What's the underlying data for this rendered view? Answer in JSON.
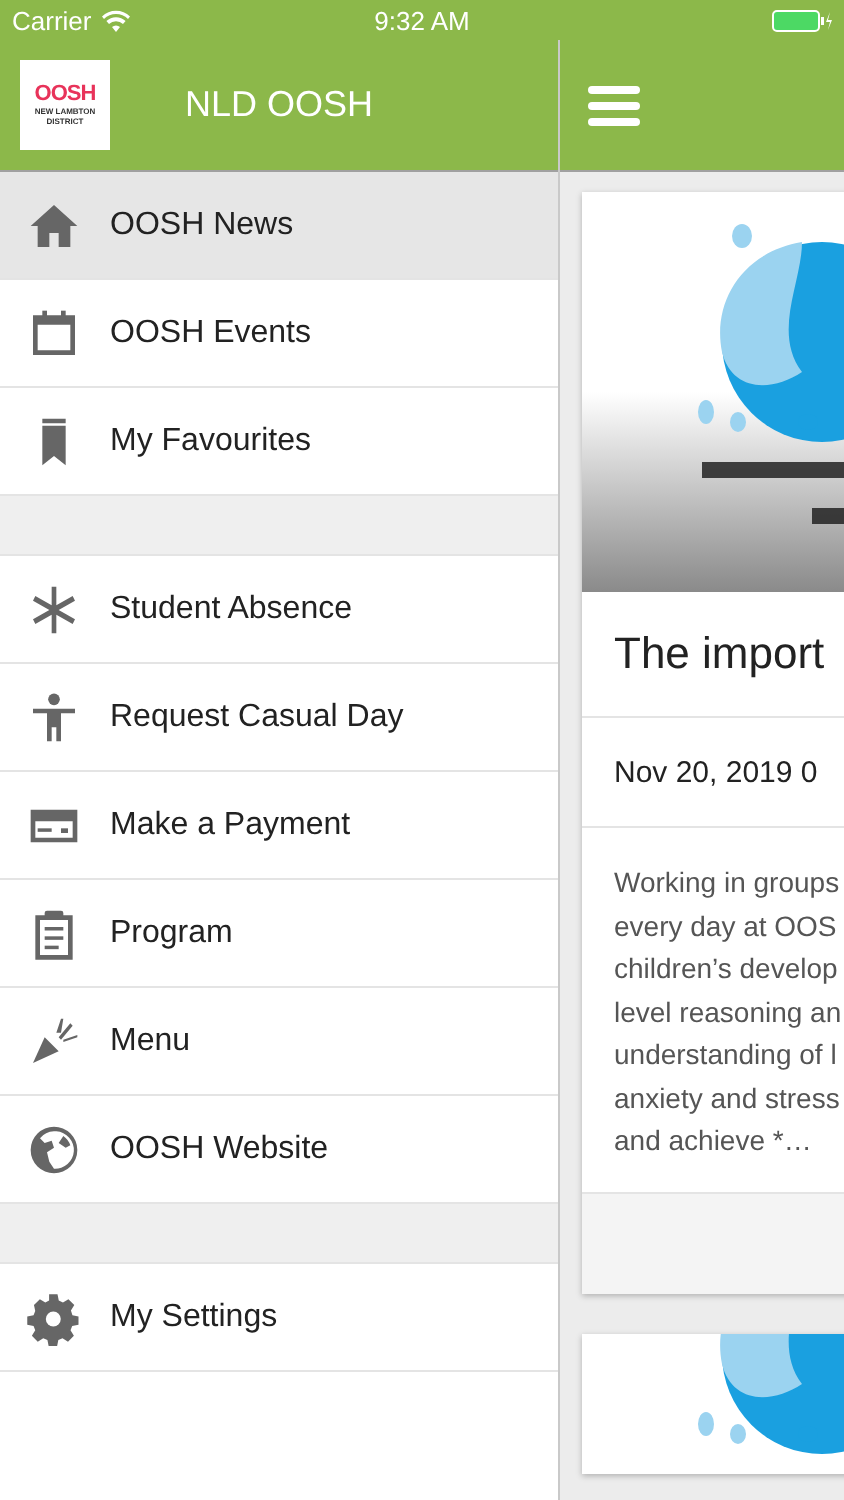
{
  "status_bar": {
    "carrier": "Carrier",
    "time": "9:32 AM"
  },
  "drawer": {
    "logo": {
      "mark": "OOSH",
      "subtitle": "NEW LAMBTON DISTRICT"
    },
    "title": "NLD OOSH",
    "sections": [
      [
        {
          "label": "OOSH News",
          "selected": true
        },
        {
          "label": "OOSH Events",
          "selected": false
        },
        {
          "label": "My Favourites",
          "selected": false
        }
      ],
      [
        {
          "label": "Student Absence",
          "selected": false
        },
        {
          "label": "Request Casual Day",
          "selected": false
        },
        {
          "label": "Make a Payment",
          "selected": false
        },
        {
          "label": "Program",
          "selected": false
        },
        {
          "label": "Menu",
          "selected": false
        },
        {
          "label": "OOSH Website",
          "selected": false
        }
      ],
      [
        {
          "label": "My Settings",
          "selected": false
        }
      ]
    ]
  },
  "feed": {
    "cards": [
      {
        "kind": "article",
        "title": "The import",
        "date": "Nov 20, 2019 0",
        "excerpt": [
          "Working in groups",
          "every day at OOS",
          "children’s develop",
          "level reasoning an",
          "understanding of l",
          "anxiety and stress",
          "and achieve *…"
        ]
      },
      {
        "kind": "picture-only"
      }
    ]
  }
}
